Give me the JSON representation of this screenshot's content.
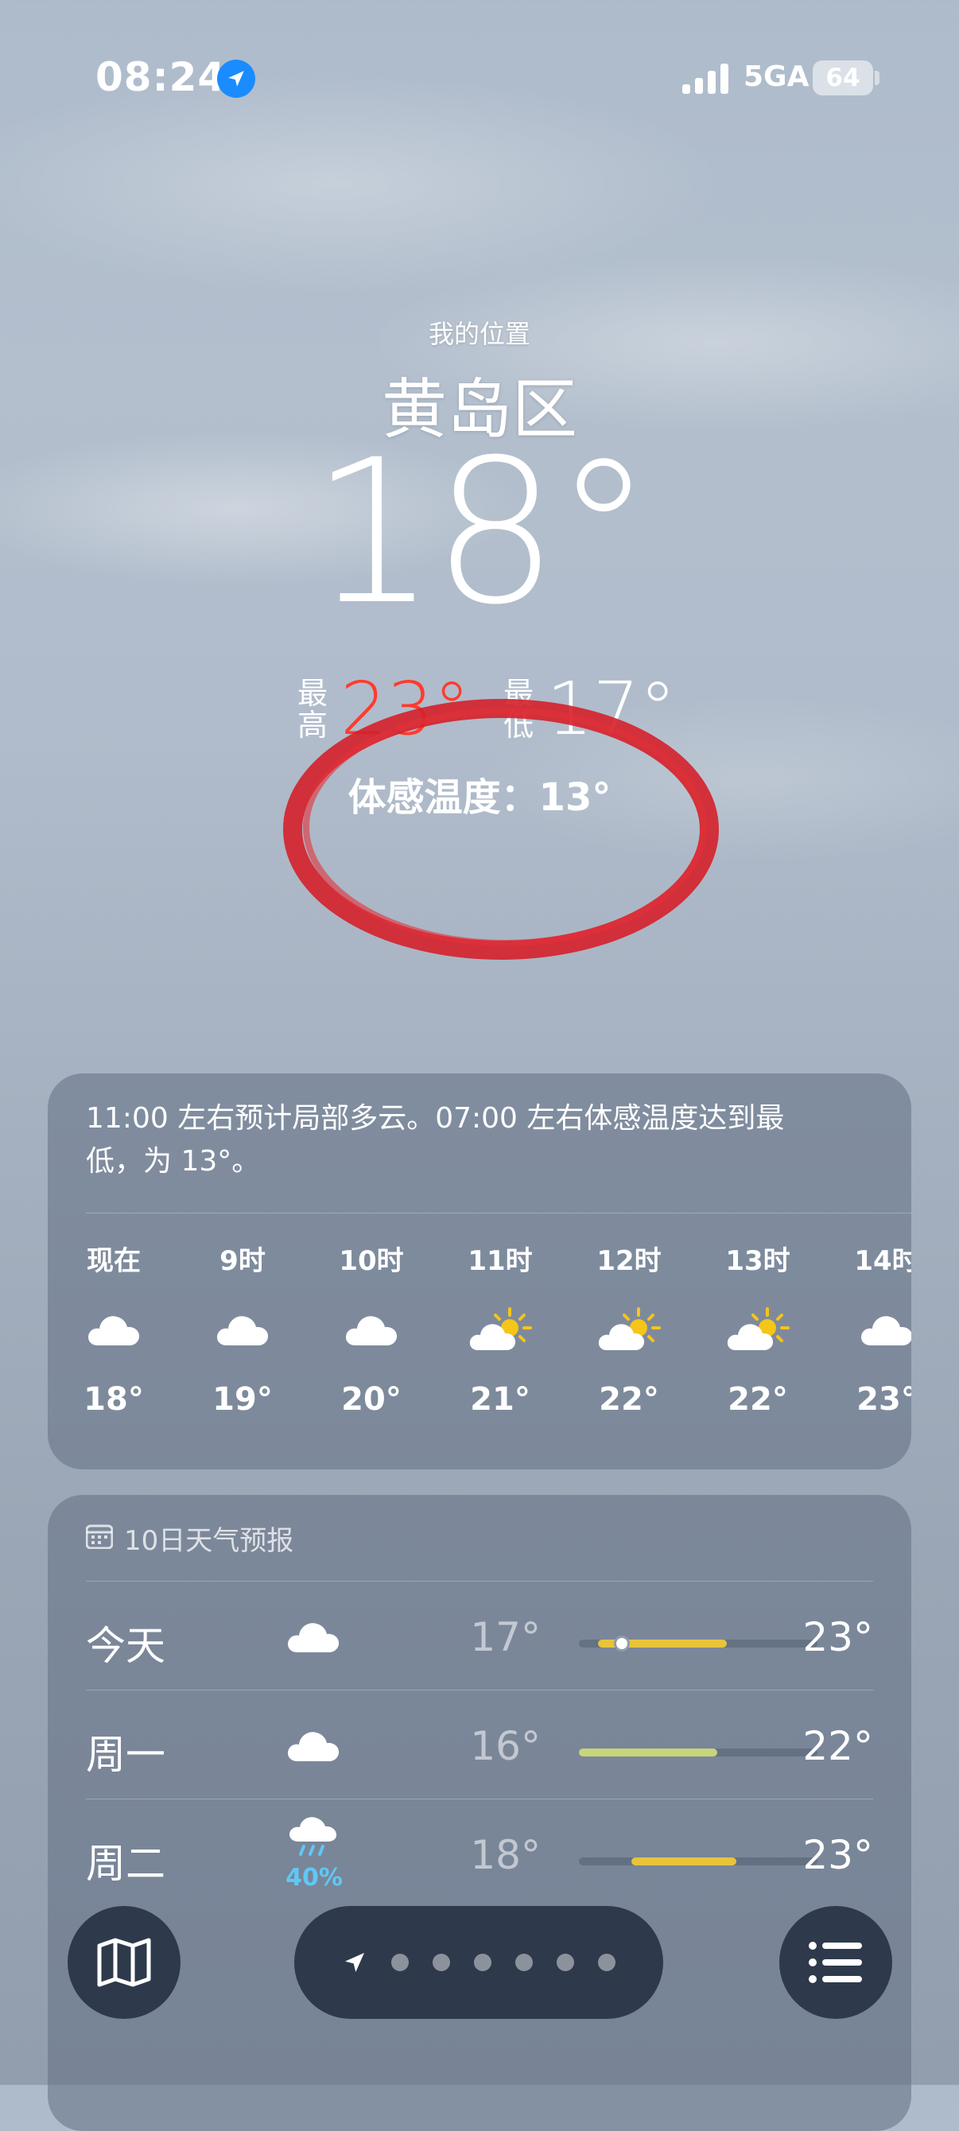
{
  "status": {
    "time": "08:24",
    "network": "5GA",
    "battery": "64"
  },
  "hero": {
    "my_location": "我的位置",
    "city": "黄岛区",
    "temperature": "18°",
    "high_label": "最高",
    "high_value": "23°",
    "low_label": "最低",
    "low_value": "17°",
    "feels_like": "体感温度：13°"
  },
  "hourly": {
    "summary": "11:00 左右预计局部多云。07:00 左右体感温度达到最低，为 13°。",
    "items": [
      {
        "label": "现在",
        "icon": "cloud-icon",
        "temp": "18°"
      },
      {
        "label": "9时",
        "icon": "cloud-icon",
        "temp": "19°"
      },
      {
        "label": "10时",
        "icon": "cloud-icon",
        "temp": "20°"
      },
      {
        "label": "11时",
        "icon": "partly-sunny-icon",
        "temp": "21°"
      },
      {
        "label": "12时",
        "icon": "partly-sunny-icon",
        "temp": "22°"
      },
      {
        "label": "13时",
        "icon": "partly-sunny-icon",
        "temp": "22°"
      },
      {
        "label": "14时",
        "icon": "cloud-icon",
        "temp": "23°"
      }
    ]
  },
  "daily": {
    "title": "10日天气预报",
    "days": [
      {
        "name": "今天",
        "icon": "cloud-icon",
        "low": "17°",
        "high": "23°",
        "precip": "",
        "range_start": 0.08,
        "range_end": 0.62,
        "current": 0.18,
        "color": "#e8c43a"
      },
      {
        "name": "周一",
        "icon": "cloud-icon",
        "low": "16°",
        "high": "22°",
        "precip": "",
        "range_start": 0.0,
        "range_end": 0.58,
        "color": "#c7d67a"
      },
      {
        "name": "周二",
        "icon": "rain-cloud-icon",
        "low": "18°",
        "high": "23°",
        "precip": "40%",
        "range_start": 0.22,
        "range_end": 0.66,
        "color": "#e8c43a"
      }
    ]
  },
  "colors": {
    "accent_red": "#ff3b30",
    "location_blue": "#1a8cff"
  }
}
